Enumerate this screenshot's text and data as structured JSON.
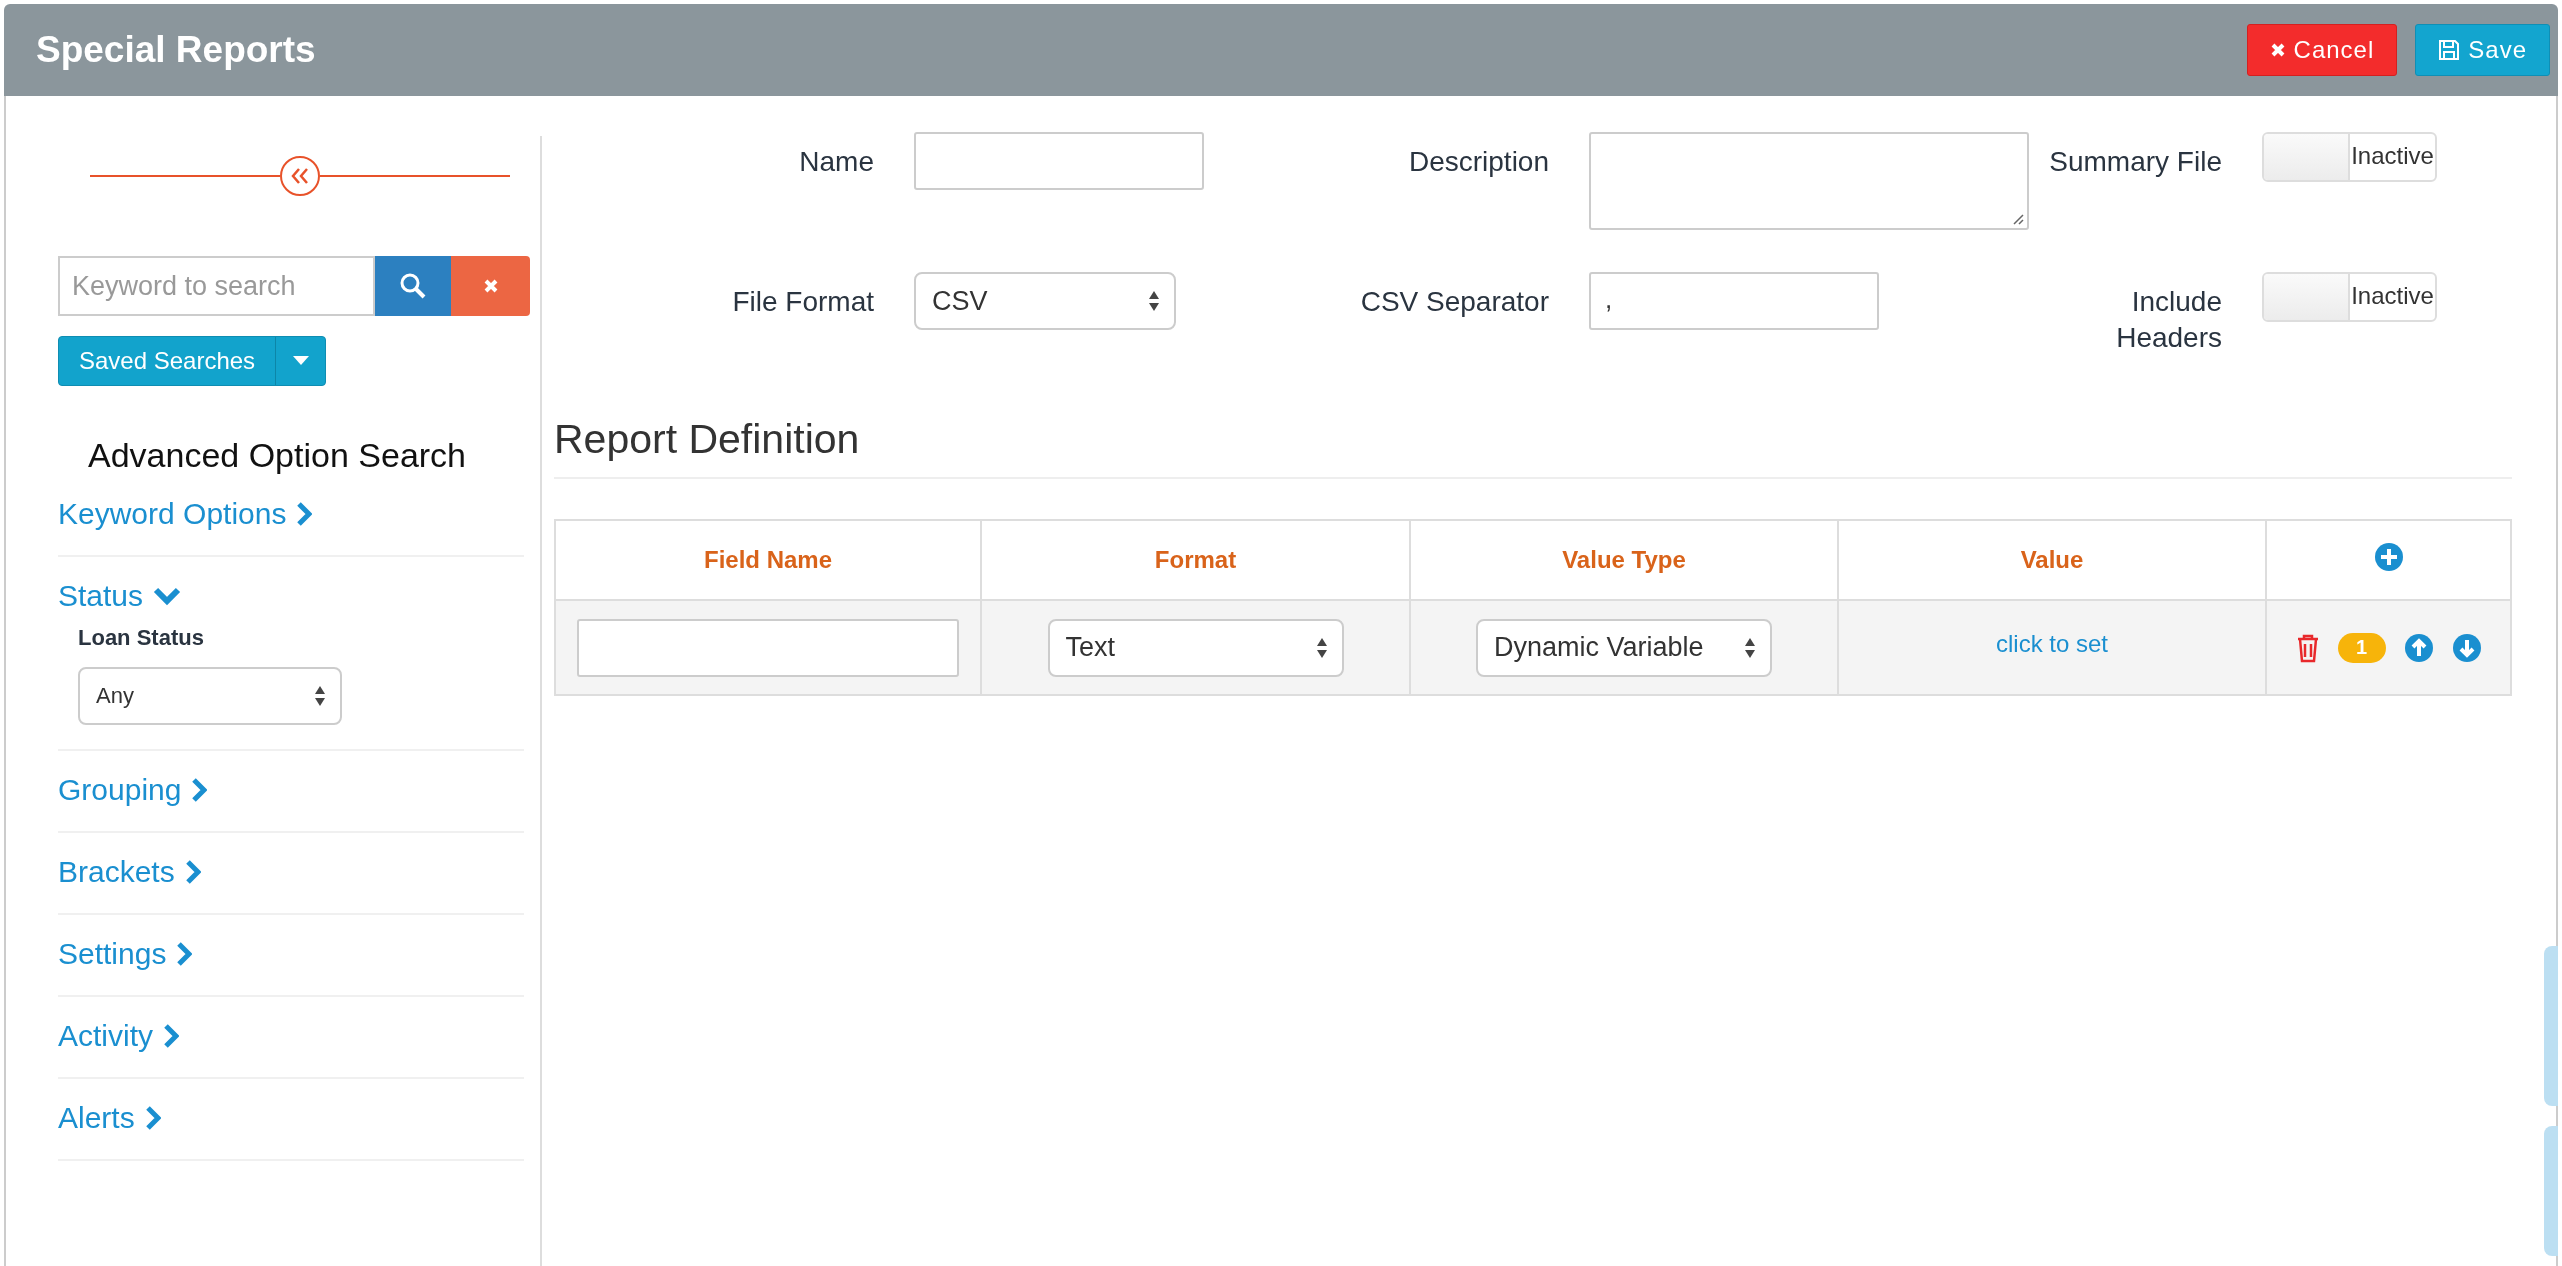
{
  "header": {
    "title": "Special Reports",
    "buttons": [
      {
        "kind": "cancel",
        "label": "Cancel"
      },
      {
        "kind": "save",
        "label": "Save"
      }
    ]
  },
  "sidebar": {
    "search": {
      "placeholder": "Keyword to search"
    },
    "saved_searches": "Saved Searches",
    "heading": "Advanced Option Search",
    "sections": [
      {
        "title": "Keyword Options",
        "expanded": false
      },
      {
        "title": "Status",
        "expanded": true,
        "fields": [
          {
            "label": "Loan Status",
            "value": "Any"
          }
        ]
      },
      {
        "title": "Grouping",
        "expanded": false
      },
      {
        "title": "Brackets",
        "expanded": false
      },
      {
        "title": "Settings",
        "expanded": false
      },
      {
        "title": "Activity",
        "expanded": false
      },
      {
        "title": "Alerts",
        "expanded": false
      }
    ]
  },
  "form": {
    "fields": [
      {
        "kind": "input",
        "label": "Name"
      },
      {
        "kind": "textarea",
        "label": "Description"
      },
      {
        "kind": "toggle",
        "label": "Summary File",
        "on": false,
        "text": "Inactive"
      },
      {
        "kind": "select",
        "label": "File Format",
        "value": "CSV"
      },
      {
        "kind": "input",
        "label": "CSV Separator",
        "value": ","
      },
      {
        "kind": "toggle",
        "label": "Include Headers",
        "on": false,
        "text": "Inactive"
      }
    ]
  },
  "report_definition": {
    "title": "Report Definition",
    "columns": [
      "Field Name",
      "Format",
      "Value Type",
      "Value"
    ],
    "rows": [
      {
        "format": "Text",
        "value_type": "Dynamic Variable",
        "value": "click to set",
        "order": "1"
      }
    ]
  }
}
